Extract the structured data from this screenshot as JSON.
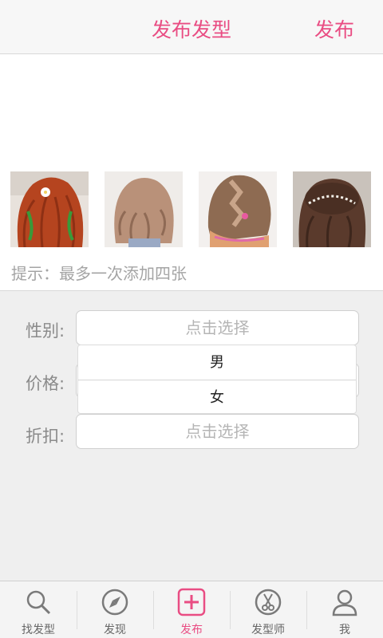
{
  "header": {
    "title": "发布发型",
    "publish_label": "发布"
  },
  "upload": {
    "hint": "提示：最多一次添加四张",
    "images": [
      {
        "name": "red-curly-hair-photo"
      },
      {
        "name": "light-brown-curly-hair-photo"
      },
      {
        "name": "braided-ombre-hair-photo"
      },
      {
        "name": "updo-with-pearl-accessory-photo"
      }
    ]
  },
  "form": {
    "gender_label": "性别:",
    "gender_placeholder": "点击选择",
    "price_label": "价格:",
    "discount_label": "折扣:",
    "discount_placeholder": "点击选择",
    "gender_options": [
      "男",
      "女"
    ]
  },
  "tabs": [
    {
      "label": "找发型",
      "icon": "search-icon"
    },
    {
      "label": "发现",
      "icon": "compass-icon"
    },
    {
      "label": "发布",
      "icon": "plus-icon",
      "active": true
    },
    {
      "label": "发型师",
      "icon": "scissors-icon"
    },
    {
      "label": "我",
      "icon": "user-icon"
    }
  ],
  "colors": {
    "accent": "#e94d83",
    "form_bg": "#efefef",
    "hint": "#a4a4a4"
  }
}
